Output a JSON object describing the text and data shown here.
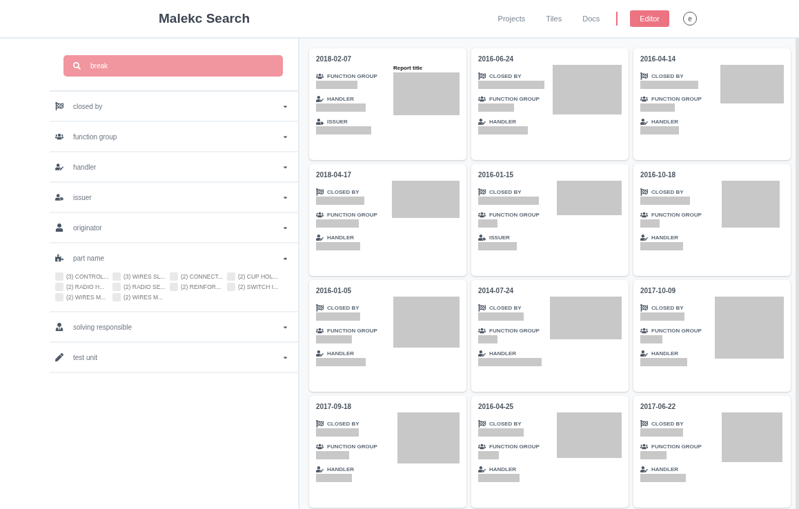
{
  "header": {
    "title": "Malekc Search",
    "nav": [
      {
        "label": "Projects",
        "kind": "link"
      },
      {
        "label": "Tiles",
        "kind": "link"
      },
      {
        "label": "Docs",
        "kind": "link"
      },
      {
        "label": "Editor",
        "kind": "button"
      }
    ],
    "avatar": "e"
  },
  "search": {
    "value": "break"
  },
  "filters": [
    {
      "kind": "flag",
      "label": "closed by",
      "expanded": false
    },
    {
      "kind": "users",
      "label": "function group",
      "expanded": false
    },
    {
      "kind": "user-edit",
      "label": "handler",
      "expanded": false
    },
    {
      "kind": "user-tag",
      "label": "issuer",
      "expanded": false
    },
    {
      "kind": "user",
      "label": "originator",
      "expanded": false
    },
    {
      "kind": "puzzle",
      "label": "part name",
      "expanded": true,
      "options": [
        {
          "label": "(3) CONTROL...",
          "checked": false
        },
        {
          "label": "(3) WIRES SL...",
          "checked": false
        },
        {
          "label": "(2) CONNECT...",
          "checked": false
        },
        {
          "label": "(2) CUP HOL...",
          "checked": false
        },
        {
          "label": "(2) RADIO H...",
          "checked": false
        },
        {
          "label": "(2) RADIO SE...",
          "checked": false
        },
        {
          "label": "(2) REINFOR...",
          "checked": false
        },
        {
          "label": "(2) SWITCH I...",
          "checked": false
        },
        {
          "label": "(2) WIRES M...",
          "checked": false
        },
        {
          "label": "(2) WIRES M...",
          "checked": false
        }
      ]
    },
    {
      "kind": "user-tie",
      "label": "solving responsible",
      "expanded": false
    },
    {
      "kind": "pen",
      "label": "test unit",
      "expanded": false
    }
  ],
  "cards": [
    {
      "date": "2018-02-07",
      "image_caption": "Report title",
      "fields": [
        {
          "kind": "function_group",
          "label": "FUNCTION GROUP"
        },
        {
          "kind": "handler",
          "label": "HANDLER"
        },
        {
          "kind": "issuer",
          "label": "ISSUER"
        }
      ]
    },
    {
      "date": "2016-06-24",
      "fields": [
        {
          "kind": "closed_by",
          "label": "CLOSED BY"
        },
        {
          "kind": "function_group",
          "label": "FUNCTION GROUP"
        },
        {
          "kind": "handler",
          "label": "HANDLER"
        }
      ]
    },
    {
      "date": "2016-04-14",
      "fields": [
        {
          "kind": "closed_by",
          "label": "CLOSED BY"
        },
        {
          "kind": "function_group",
          "label": "FUNCTION GROUP"
        },
        {
          "kind": "handler",
          "label": "HANDLER"
        }
      ]
    },
    {
      "date": "2018-04-17",
      "fields": [
        {
          "kind": "closed_by",
          "label": "CLOSED BY"
        },
        {
          "kind": "function_group",
          "label": "FUNCTION GROUP"
        },
        {
          "kind": "handler",
          "label": "HANDLER"
        }
      ]
    },
    {
      "date": "2016-01-15",
      "fields": [
        {
          "kind": "closed_by",
          "label": "CLOSED BY"
        },
        {
          "kind": "function_group",
          "label": "FUNCTION GROUP"
        },
        {
          "kind": "issuer",
          "label": "ISSUER"
        }
      ]
    },
    {
      "date": "2016-10-18",
      "fields": [
        {
          "kind": "closed_by",
          "label": "CLOSED BY"
        },
        {
          "kind": "function_group",
          "label": "FUNCTION GROUP"
        },
        {
          "kind": "handler",
          "label": "HANDLER"
        }
      ]
    },
    {
      "date": "2016-01-05",
      "fields": [
        {
          "kind": "closed_by",
          "label": "CLOSED BY"
        },
        {
          "kind": "function_group",
          "label": "FUNCTION GROUP"
        },
        {
          "kind": "handler",
          "label": "HANDLER"
        }
      ]
    },
    {
      "date": "2014-07-24",
      "fields": [
        {
          "kind": "closed_by",
          "label": "CLOSED BY"
        },
        {
          "kind": "function_group",
          "label": "FUNCTION GROUP"
        },
        {
          "kind": "handler",
          "label": "HANDLER"
        }
      ]
    },
    {
      "date": "2017-10-09",
      "fields": [
        {
          "kind": "closed_by",
          "label": "CLOSED BY"
        },
        {
          "kind": "function_group",
          "label": "FUNCTION GROUP"
        },
        {
          "kind": "handler",
          "label": "HANDLER"
        }
      ]
    },
    {
      "date": "2017-09-18",
      "fields": [
        {
          "kind": "closed_by",
          "label": "CLOSED BY"
        },
        {
          "kind": "function_group",
          "label": "FUNCTION GROUP"
        },
        {
          "kind": "handler",
          "label": "HANDLER"
        }
      ]
    },
    {
      "date": "2016-04-25",
      "fields": [
        {
          "kind": "closed_by",
          "label": "CLOSED BY"
        },
        {
          "kind": "function_group",
          "label": "FUNCTION GROUP"
        },
        {
          "kind": "handler",
          "label": "HANDLER"
        }
      ]
    },
    {
      "date": "2017-06-22",
      "fields": [
        {
          "kind": "closed_by",
          "label": "CLOSED BY"
        },
        {
          "kind": "function_group",
          "label": "FUNCTION GROUP"
        },
        {
          "kind": "handler",
          "label": "HANDLER"
        }
      ]
    }
  ]
}
